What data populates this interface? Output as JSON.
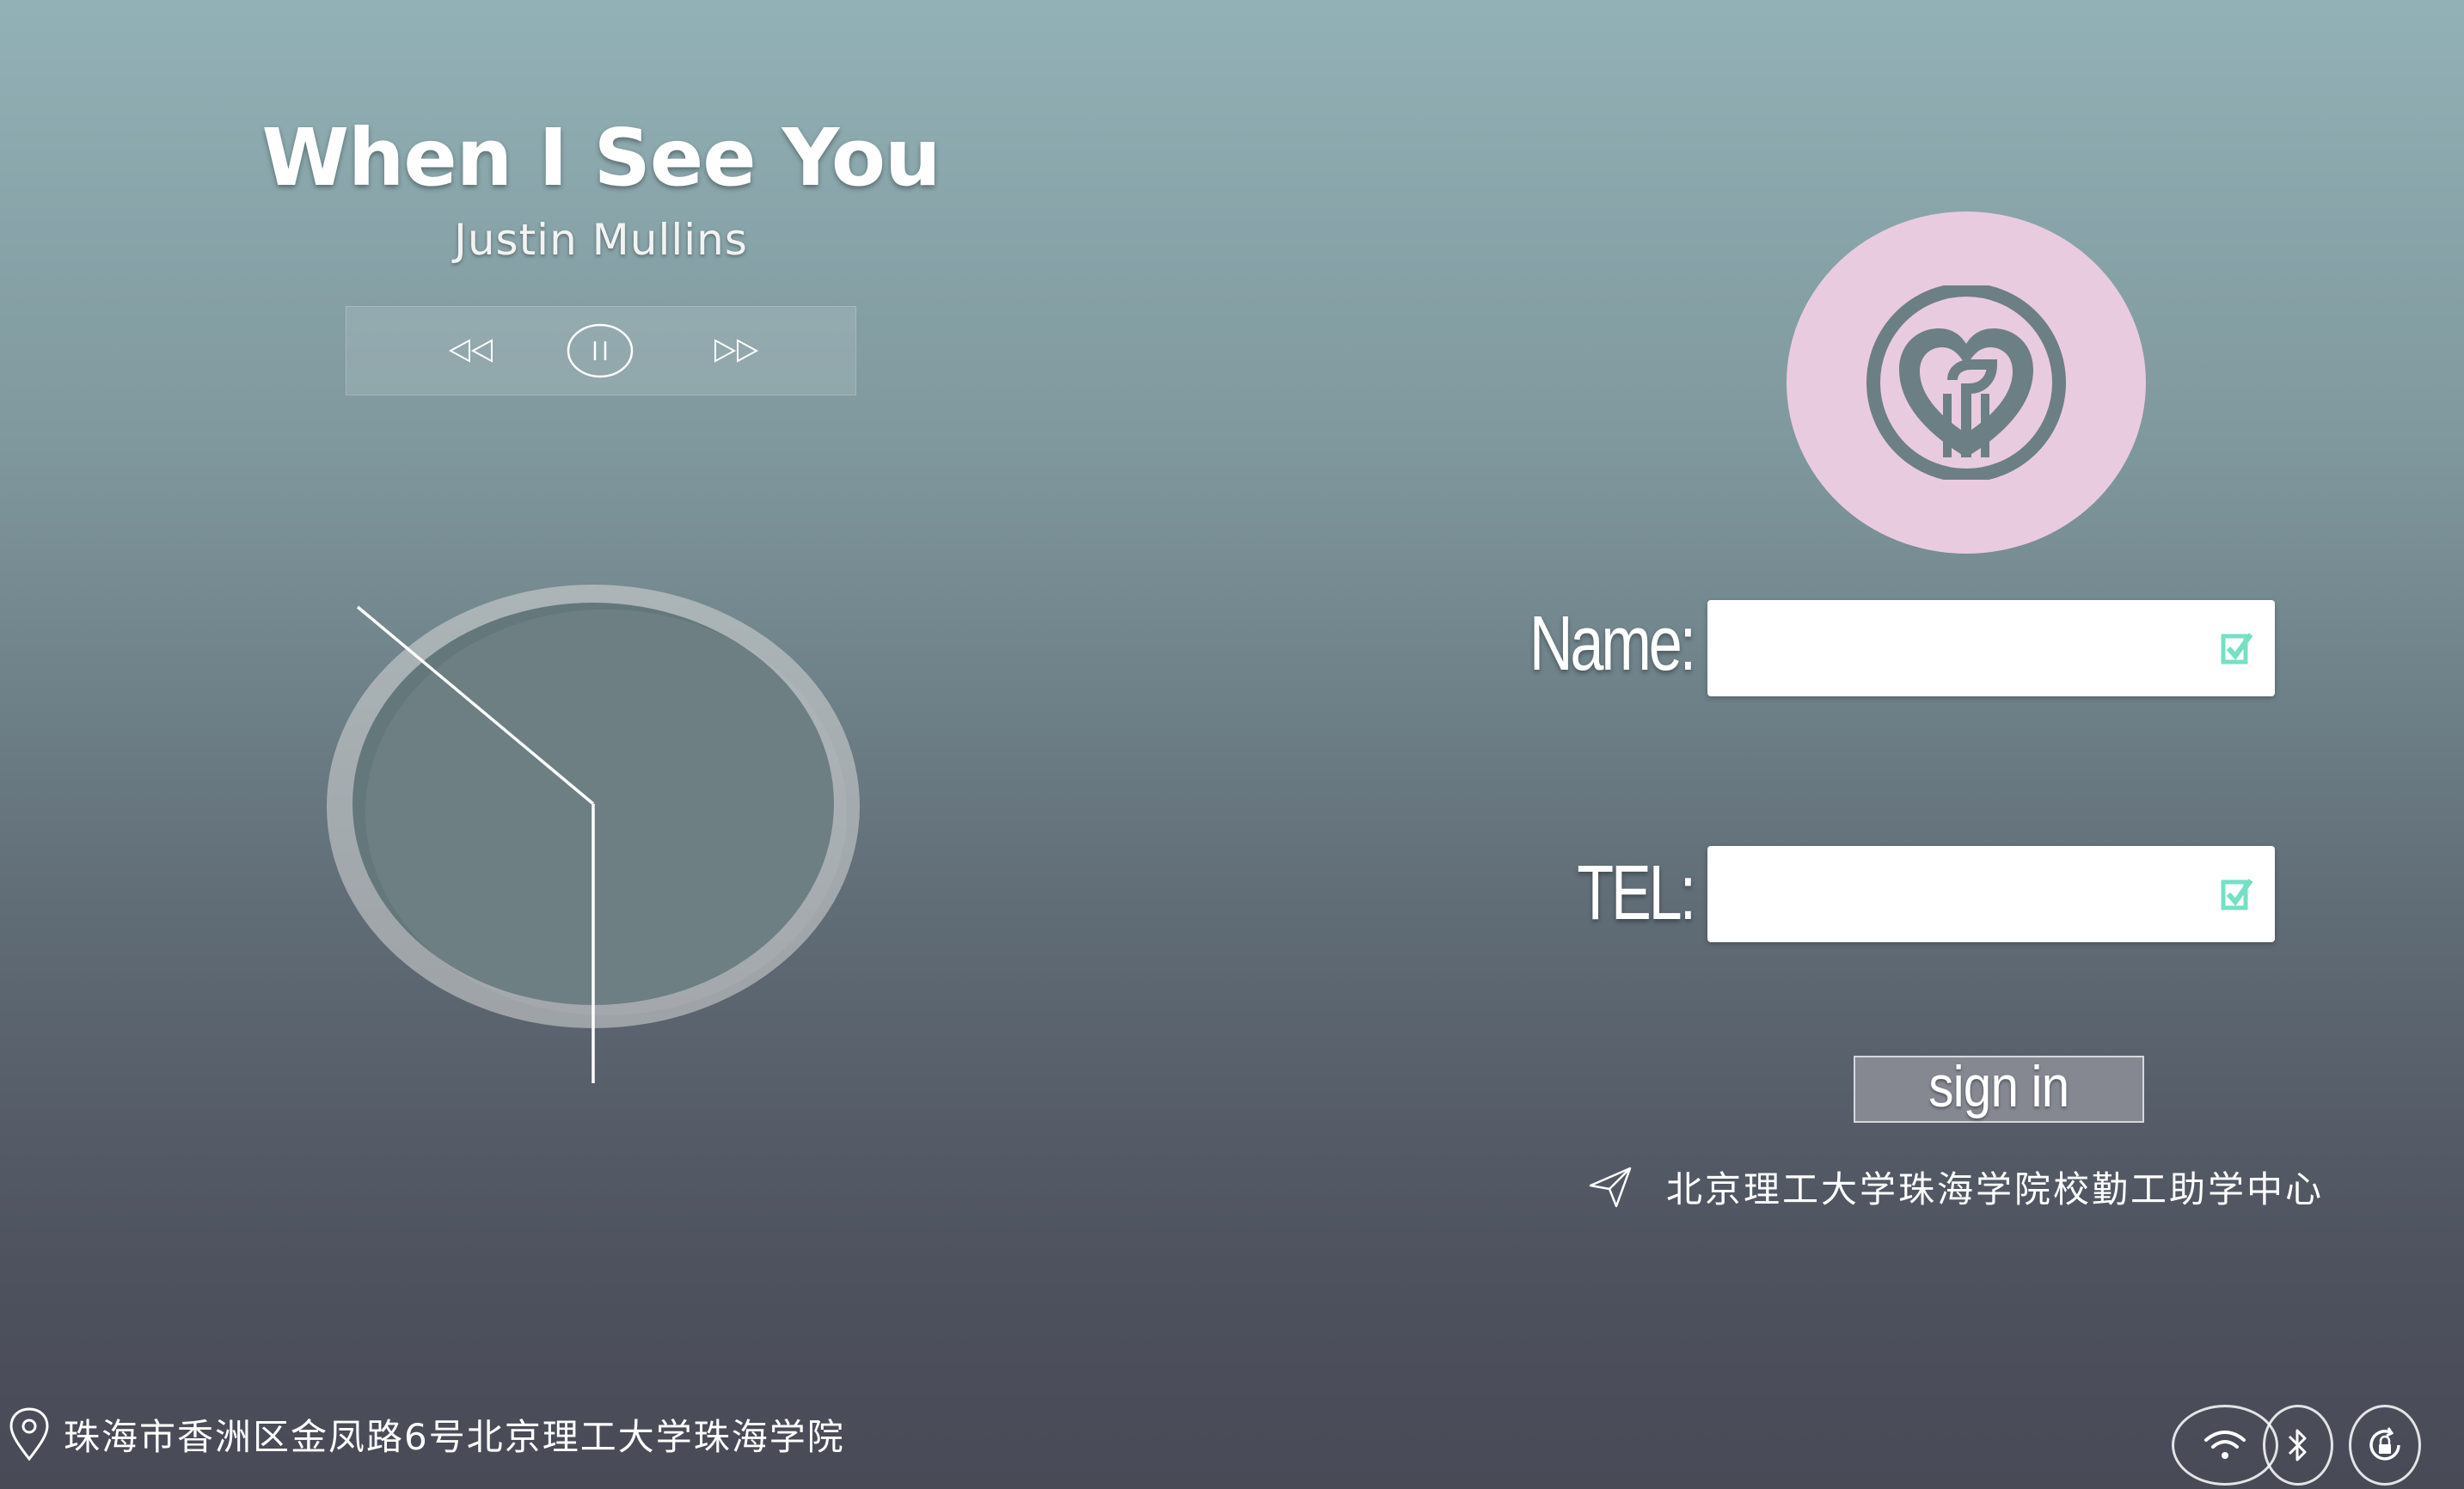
{
  "player": {
    "title": "When I See You",
    "artist": "Justin Mullins",
    "controls": {
      "prev_icon": "rewind-icon",
      "pause_icon": "pause-icon",
      "next_icon": "fast-forward-icon"
    },
    "clock_icon": "analog-clock"
  },
  "login": {
    "logo_icon": "heart-sprout-logo-icon",
    "name_label": "Name:",
    "tel_label": "TEL:",
    "name_value": "",
    "tel_value": "",
    "field_icon": "check-square-icon",
    "submit_label": "sign in",
    "organization": "北京理工大学珠海学院校勤工助学中心",
    "organization_icon": "send-icon",
    "accent_color": "#74e0c5",
    "logo_bg_color": "#e9cbdf"
  },
  "footer": {
    "address": "珠海市香洲区金凤路6号北京理工大学珠海学院",
    "address_icon": "location-pin-icon",
    "status_icons": [
      "wifi-icon",
      "bluetooth-icon",
      "rotation-lock-icon"
    ]
  }
}
